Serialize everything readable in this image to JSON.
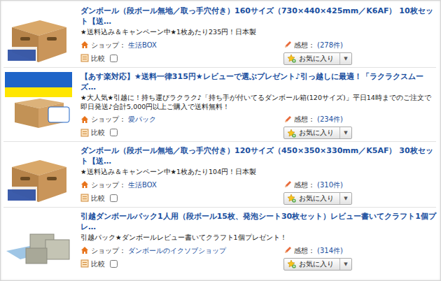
{
  "items": [
    {
      "kind": "box",
      "title": "ダンボール（段ボール無地／取っ手穴付き）160サイズ（730×440×425mm／K6AF） 10枚セット【送…",
      "subtitle": "★送料込み＆キャンペーン中★1枚あたり235円！日本製",
      "shop_label": "ショップ：",
      "shop": "生活BOX",
      "review_label": "感想：",
      "reviews": "(278件)",
      "compare_label": "比較",
      "compare_checked": false,
      "favorite": "お気に入り",
      "dropdown": "▼"
    },
    {
      "kind": "banner",
      "title": "【あす楽対応】★送料一律315円★レビューで選ぶプレゼント♪引っ越しに最適！「ラクラクスムーズ…",
      "subtitle": "★大人気★引越に！持ち運びラクラク♪「持ち手が付いてるダンボール箱(120サイズ)」平日14時までのご注文で即日発送♪合計5,000円以上ご購入で送料無料！",
      "shop_label": "ショップ：",
      "shop": "愛パック",
      "review_label": "感想：",
      "reviews": "(234件)",
      "compare_label": "比較",
      "compare_checked": false,
      "favorite": "お気に入り",
      "dropdown": "▼"
    },
    {
      "kind": "box",
      "title": "ダンボール（段ボール無地／取っ手穴付き）120サイズ（450×350×330mm／K5AF） 30枚セット【送…",
      "subtitle": "★送料込み＆キャンペーン中★1枚あたり104円！日本製",
      "shop_label": "ショップ：",
      "shop": "生活BOX",
      "review_label": "感想：",
      "reviews": "(310件)",
      "compare_label": "比較",
      "compare_checked": false,
      "favorite": "お気に入り",
      "dropdown": "▼"
    },
    {
      "kind": "pack",
      "title": "引越ダンボールパック1人用（段ボール15枚、発泡シート30枚セット）レビュー書いてクラフト1個プレ…",
      "subtitle": "引越パック★ダンボールレビュー書いてクラフト1個プレゼント！",
      "shop_label": "ショップ：",
      "shop": "ダンボールのイクソブショップ",
      "review_label": "感想：",
      "reviews": "(314件)",
      "compare_label": "比較",
      "compare_checked": false,
      "favorite": "お気に入り",
      "dropdown": "▼"
    }
  ]
}
